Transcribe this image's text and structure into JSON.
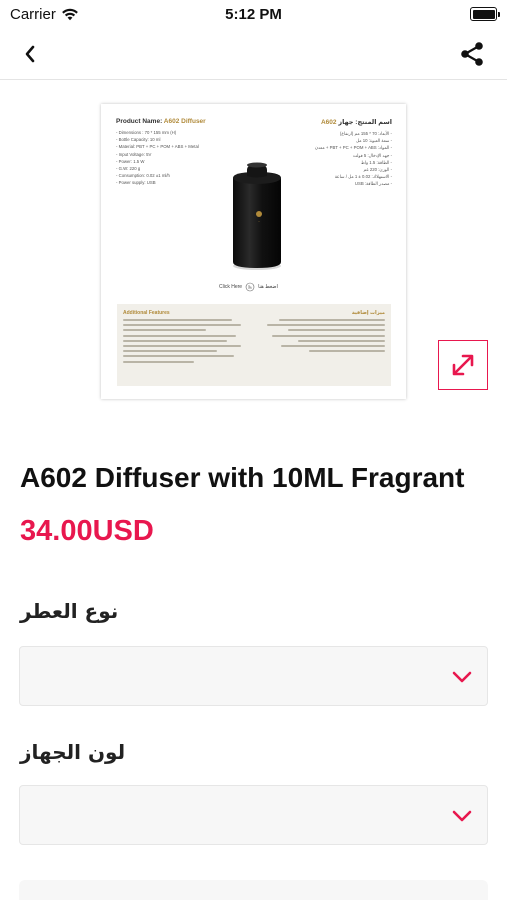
{
  "status_bar": {
    "carrier": "Carrier",
    "time": "5:12 PM",
    "battery_level": 1.0
  },
  "nav": {
    "back_icon": "chevron-left-icon",
    "share_icon": "share-icon"
  },
  "product_image": {
    "sheet": {
      "name_label": "Product Name: ",
      "name_value": "A602 Diffuser",
      "name_label_ar": "اسم المنتج: جهاز",
      "name_value_ar": "A602",
      "specs": [
        "- Dimensions : 70 * 155 mm (H)",
        "- Bottle Capacity: 10 ml",
        "- Material: PBT + PC + POM + ABS + Metal",
        "- Input Voltage: 5V",
        "- Power: 1.5 W",
        "- G.W: 220 g",
        "- Consumption: 0.02 ±1 ml/h",
        "- Power supply: USB"
      ],
      "specs_ar": [
        "- الأبعاد: 70 * 155 مم (ارتفاع)",
        "- سعة العبوة: 10 مل",
        "- المواد: PBT + PC + POM + ABS + معدن",
        "- جهد الإدخال: 5 فولت",
        "- الطاقة: 1.5 واط",
        "- الوزن: 220 غم",
        "- الاستهلاك: 0.02 ± 1 مل / ساعة",
        "- مصدر الطاقة: USB"
      ],
      "click_here": "Click Here",
      "click_here_ar": "اضغط هنا",
      "features_title": "Additional Features",
      "features_title_ar": "ميزات إضافية"
    }
  },
  "expand_icon": "expand-icon",
  "product": {
    "title": "A602 Diffuser with 10ML Fragrant",
    "price": "34.00USD"
  },
  "options": [
    {
      "label": "نوع العطر",
      "value": ""
    },
    {
      "label": "لون الجهاز",
      "value": ""
    }
  ],
  "colors": {
    "accent": "#e8174e",
    "gold": "#b08a3a"
  }
}
